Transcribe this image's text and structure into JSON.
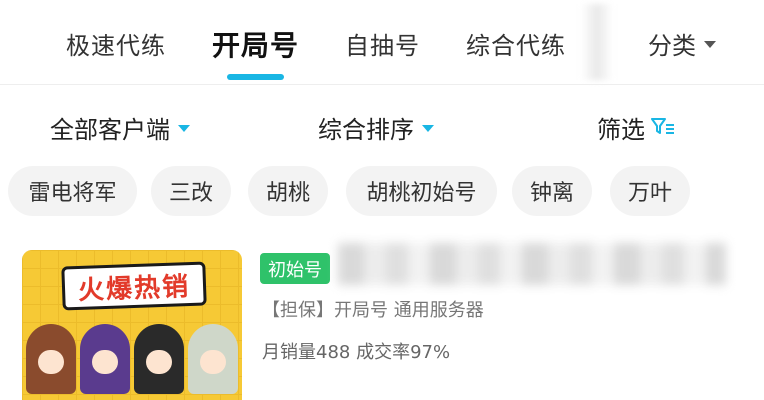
{
  "tabs": [
    {
      "label": "极速代练"
    },
    {
      "label": "开局号",
      "active": true
    },
    {
      "label": "自抽号"
    },
    {
      "label": "综合代练"
    }
  ],
  "category": {
    "label": "分类"
  },
  "filters": {
    "client": "全部客户端",
    "sort": "综合排序",
    "filter": "筛选"
  },
  "chips": [
    "雷电将军",
    "三改",
    "胡桃",
    "胡桃初始号",
    "钟离",
    "万叶"
  ],
  "listing": {
    "image_title": "火爆热销",
    "badge": "初始号",
    "meta": "【担保】开局号  通用服务器",
    "stats": "月销量488 成交率97%"
  },
  "colors": {
    "accent": "#19b6e4",
    "badge_green": "#2fc26a",
    "chip_bg": "#f3f3f3"
  },
  "icons": {
    "category_caret": "caret-down-icon",
    "client_caret": "caret-down-icon",
    "sort_caret": "caret-down-icon",
    "filter": "filter-icon"
  }
}
